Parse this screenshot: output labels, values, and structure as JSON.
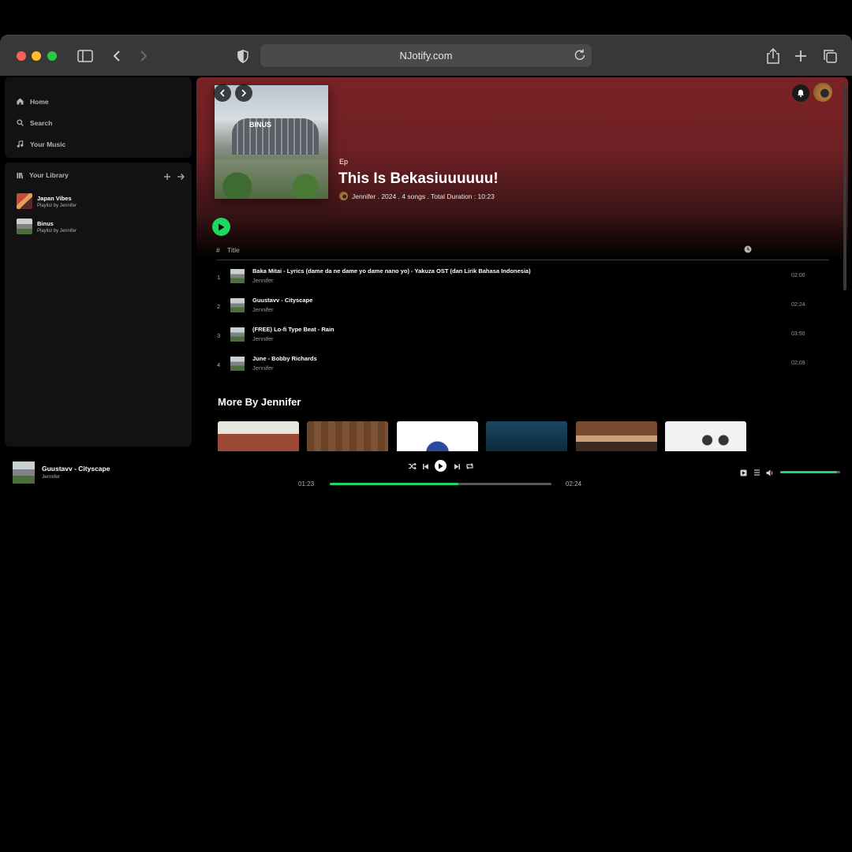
{
  "browser": {
    "url": "NJotify.com"
  },
  "sidebar": {
    "nav": [
      {
        "label": "Home",
        "icon": "home-icon"
      },
      {
        "label": "Search",
        "icon": "search-icon"
      },
      {
        "label": "Your Music",
        "icon": "music-note-icon"
      }
    ],
    "library": {
      "title": "Your Library",
      "items": [
        {
          "name": "Japan Vibes",
          "sub": "Playlist by Jennifer"
        },
        {
          "name": "Binus",
          "sub": "Playlist by Jennifer"
        }
      ]
    }
  },
  "album": {
    "cover_label": "BINUS",
    "kind": "Ep",
    "title": "This Is Bekasiuuuuuu!",
    "meta": "Jennifer . 2024 . 4 songs .  Total Duration : 10:23"
  },
  "tracklist": {
    "header_num": "#",
    "header_title": "Title",
    "tracks": [
      {
        "num": "1",
        "title": "Baka Mitai - Lyrics (dame da ne dame yo dame nano yo) - Yakuza OST (dan Lirik Bahasa Indonesia)",
        "artist": "Jennifer",
        "duration": "02:00"
      },
      {
        "num": "2",
        "title": "Guustavv - Cityscape",
        "artist": "Jennifer",
        "duration": "02:24"
      },
      {
        "num": "3",
        "title": "(FREE) Lo-fi Type Beat - Rain",
        "artist": "Jennifer",
        "duration": "03:50"
      },
      {
        "num": "4",
        "title": "June - Bobby Richards",
        "artist": "Jennifer",
        "duration": "02:09"
      }
    ]
  },
  "more": {
    "title": "More By Jennifer"
  },
  "player": {
    "now_title": "Guustavv - Cityscape",
    "now_artist": "Jennifer",
    "elapsed": "01:23",
    "total": "02:24",
    "progress": 0.58,
    "volume": 0.95
  },
  "colors": {
    "accent": "#1ed760",
    "hero": "#7a2326"
  }
}
